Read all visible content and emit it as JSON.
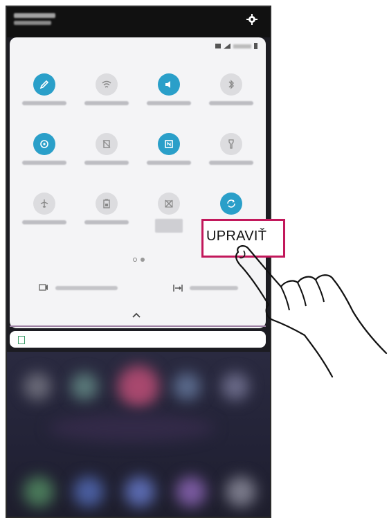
{
  "callout": {
    "label": "UPRAVIŤ"
  },
  "colors": {
    "tile_on": "#2a9fc9",
    "tile_off": "#dcdcdf",
    "callout_border": "#c2185b"
  },
  "tiles": [
    {
      "icon": "pencil-icon",
      "state": "on"
    },
    {
      "icon": "wifi-icon",
      "state": "off"
    },
    {
      "icon": "sound-icon",
      "state": "on"
    },
    {
      "icon": "bluetooth-icon",
      "state": "off"
    },
    {
      "icon": "location-icon",
      "state": "on"
    },
    {
      "icon": "rotate-lock-icon",
      "state": "off"
    },
    {
      "icon": "nfc-icon",
      "state": "on"
    },
    {
      "icon": "flashlight-icon",
      "state": "off"
    },
    {
      "icon": "airplane-icon",
      "state": "off"
    },
    {
      "icon": "battery-saver-icon",
      "state": "off"
    },
    {
      "icon": "data-off-icon",
      "state": "off"
    },
    {
      "icon": "sync-icon",
      "state": "on"
    }
  ],
  "page_indicator": {
    "current": 1,
    "total": 2
  }
}
